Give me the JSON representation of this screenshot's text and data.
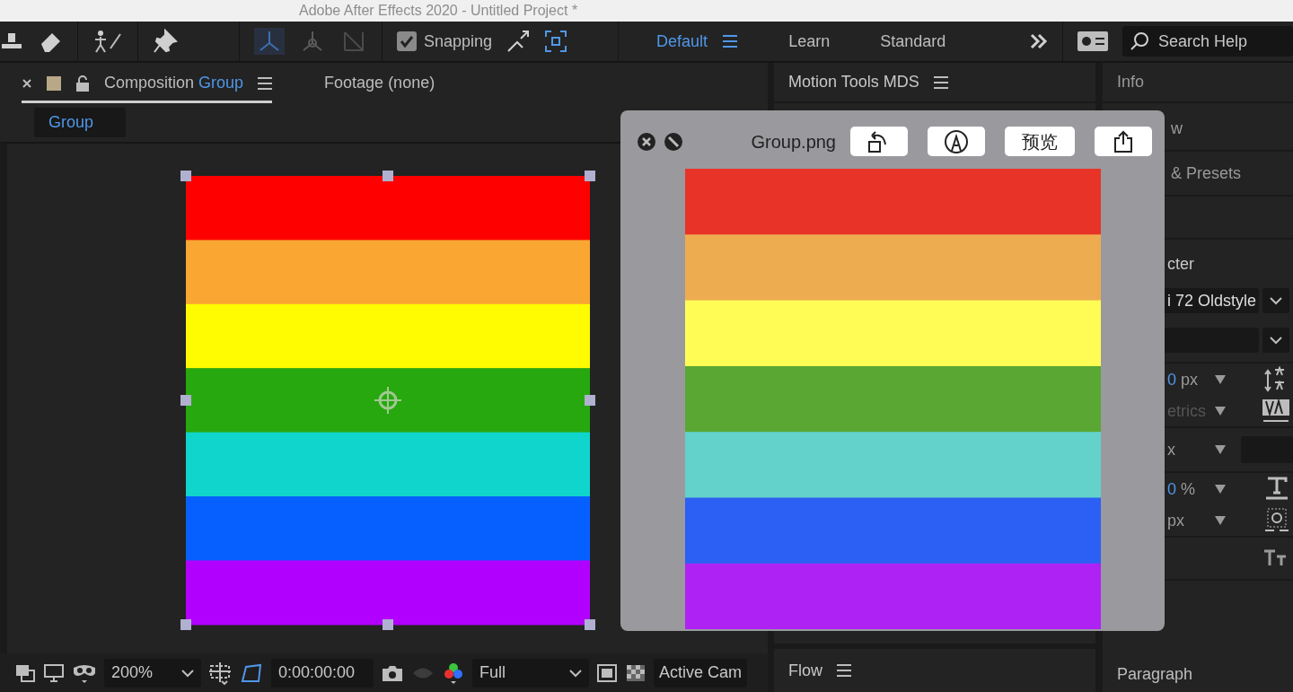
{
  "window": {
    "title": "Adobe After Effects 2020 - Untitled Project *"
  },
  "toolbar": {
    "snapping": {
      "label": "Snapping",
      "checked": true
    },
    "workspaces": [
      {
        "label": "Default",
        "selected": true
      },
      {
        "label": "Learn",
        "selected": false
      },
      {
        "label": "Standard",
        "selected": false
      }
    ],
    "search": {
      "placeholder": "Search Help"
    }
  },
  "composition_panel": {
    "tabs": [
      {
        "label": "Composition",
        "comp": "Group",
        "selected": true
      },
      {
        "label": "Footage (none)",
        "selected": false
      }
    ],
    "breadcrumb": "Group",
    "footer": {
      "zoom": "200%",
      "timecode": "0:00:00:00",
      "resolution": "Full",
      "camera": "Active Cam"
    }
  },
  "motion_tools_panel": {
    "title": "Motion Tools MDS"
  },
  "flow_panel": {
    "title": "Flow"
  },
  "preview_window": {
    "title": "Group.png",
    "buttons": [
      {
        "kind": "rotate"
      },
      {
        "kind": "markup"
      },
      {
        "kind": "text",
        "label": "预览"
      },
      {
        "kind": "share"
      }
    ]
  },
  "info_panel": {
    "title": "Info",
    "sections": [
      "w",
      "& Presets"
    ]
  },
  "character_panel": {
    "title": "cter",
    "font": "i 72 Oldstyle",
    "rows": [
      {
        "value": "0",
        "unit": "px",
        "disabled": false
      },
      {
        "value": "etrics",
        "disabled": true
      },
      {
        "value": "x",
        "disabled": false
      },
      {
        "value": "0",
        "unit": "%",
        "disabled": false
      },
      {
        "value": "px",
        "disabled": false
      }
    ]
  },
  "paragraph_panel": {
    "title": "Paragraph"
  }
}
